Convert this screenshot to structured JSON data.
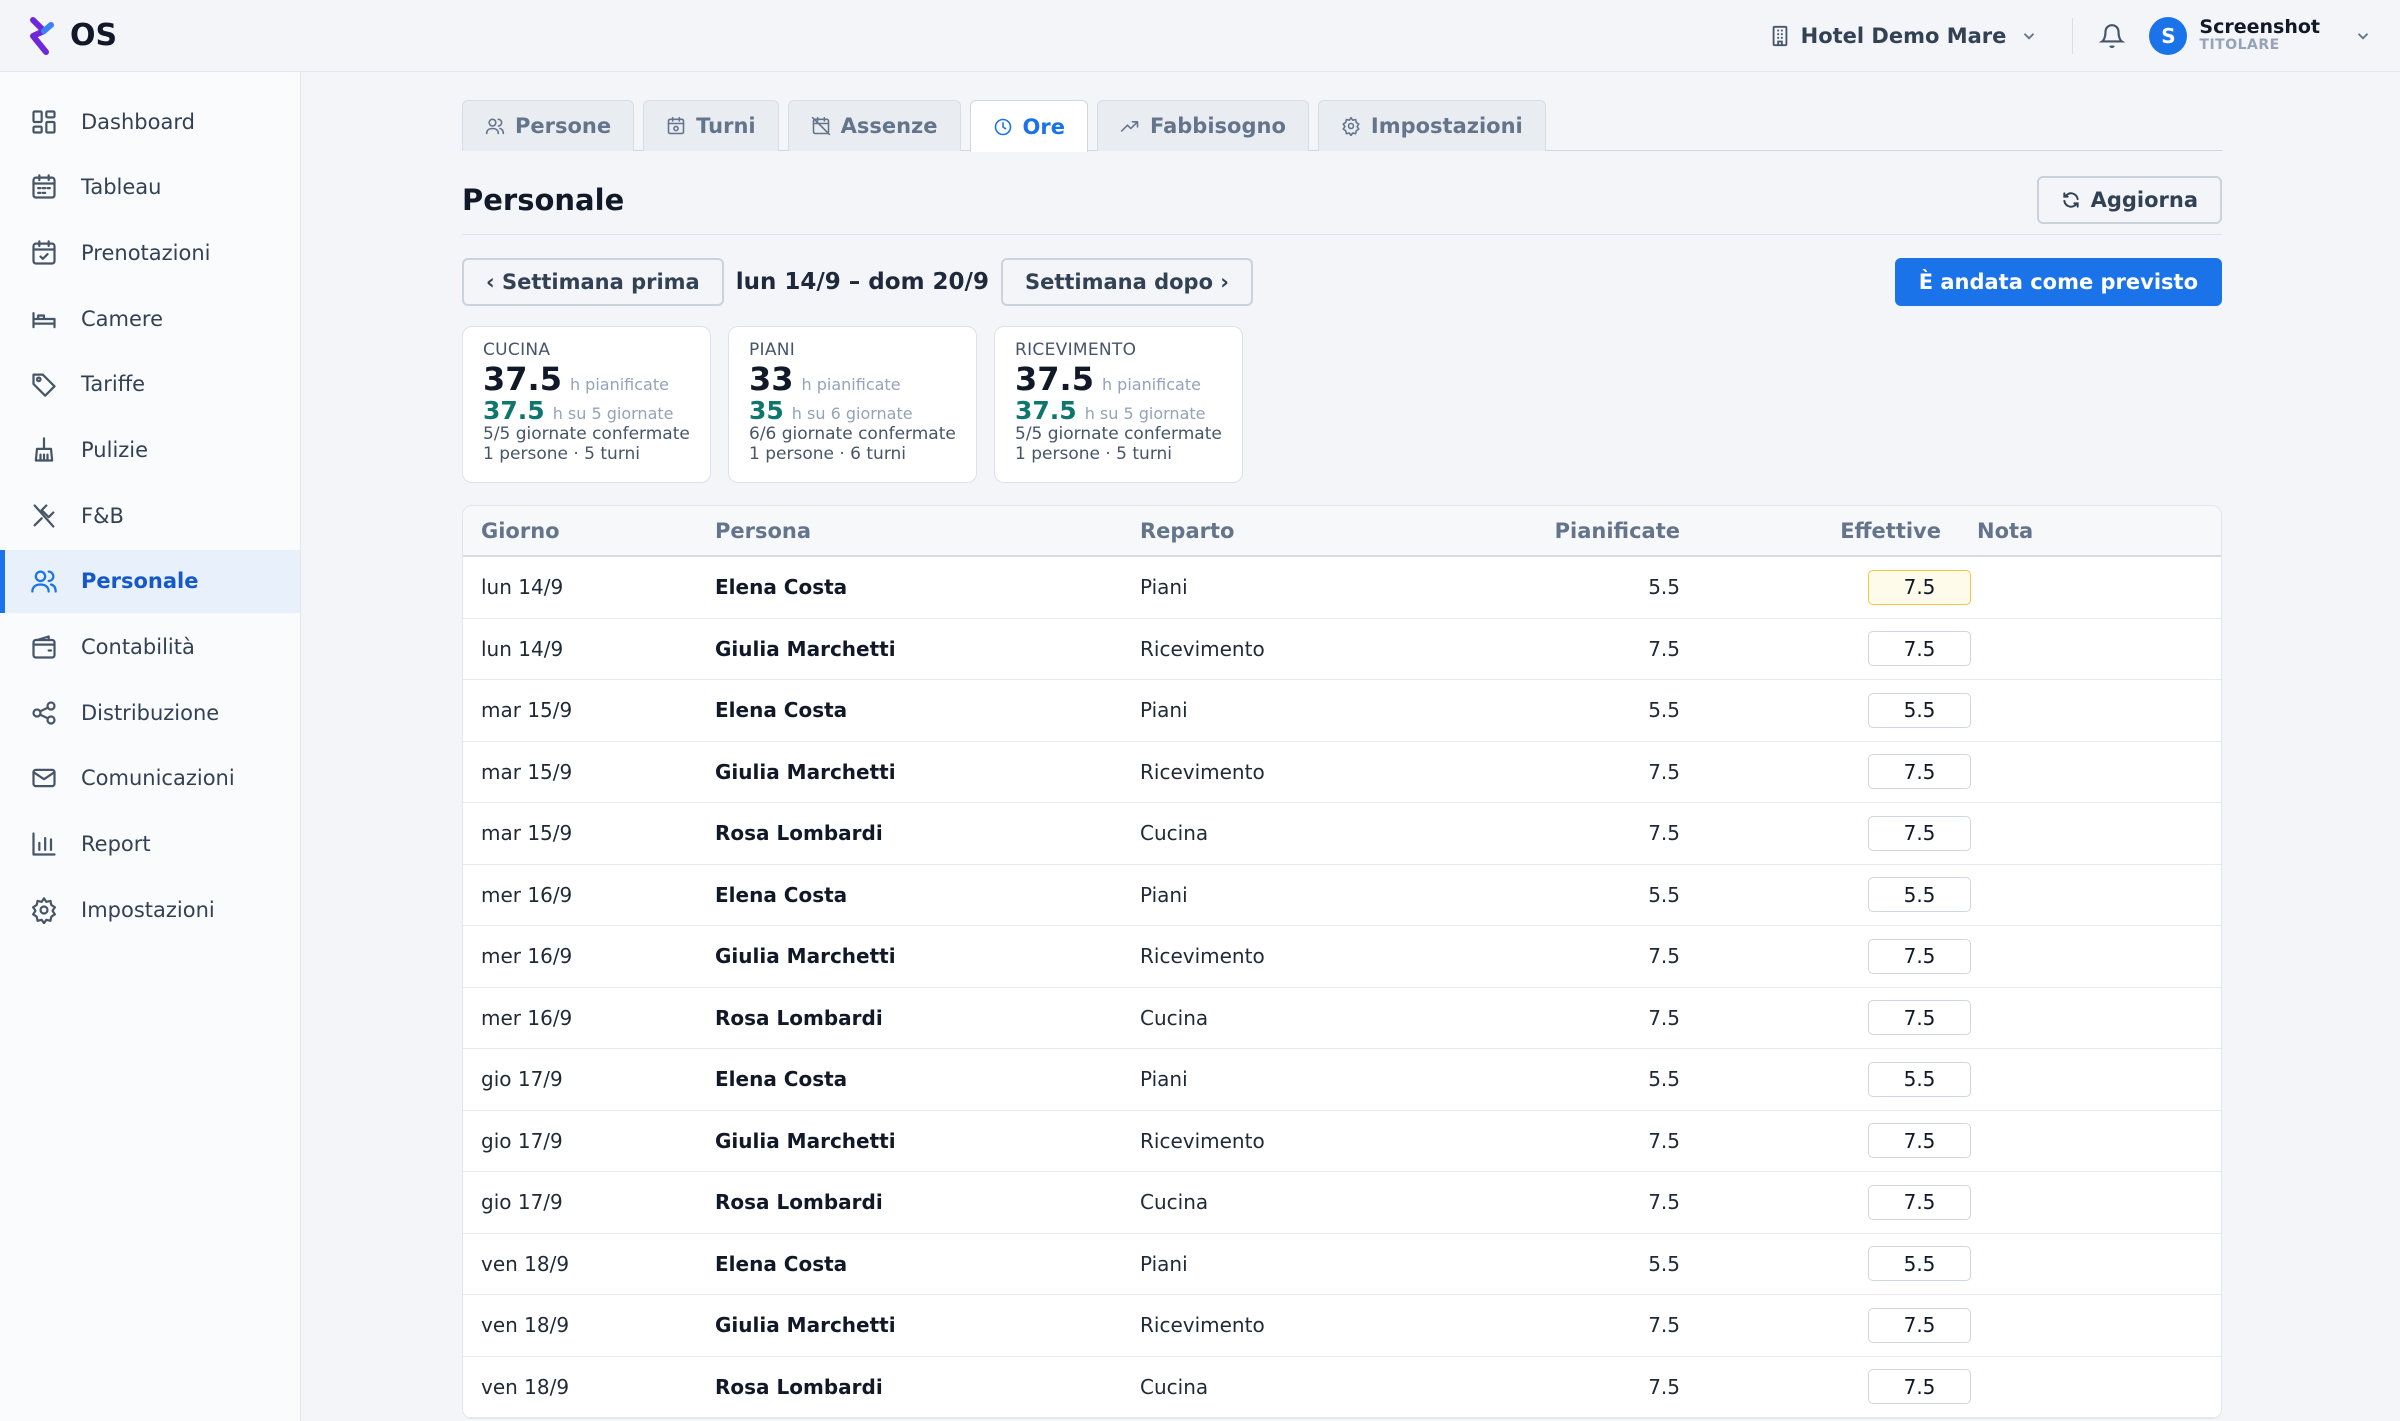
{
  "app": {
    "name": "OS",
    "accent": "#1a73e8"
  },
  "topbar": {
    "hotel": "Hotel Demo Mare",
    "user_initial": "S",
    "user_name": "Screenshot",
    "user_role": "TITOLARE"
  },
  "sidebar": {
    "items": [
      {
        "label": "Dashboard",
        "icon": "dashboard-icon"
      },
      {
        "label": "Tableau",
        "icon": "calendar-grid-icon"
      },
      {
        "label": "Prenotazioni",
        "icon": "calendar-check-icon"
      },
      {
        "label": "Camere",
        "icon": "bed-icon"
      },
      {
        "label": "Tariffe",
        "icon": "tag-icon"
      },
      {
        "label": "Pulizie",
        "icon": "broom-icon"
      },
      {
        "label": "F&B",
        "icon": "utensils-icon"
      },
      {
        "label": "Personale",
        "icon": "users-icon",
        "active": true
      },
      {
        "label": "Contabilità",
        "icon": "wallet-icon"
      },
      {
        "label": "Distribuzione",
        "icon": "share-icon"
      },
      {
        "label": "Comunicazioni",
        "icon": "mail-icon"
      },
      {
        "label": "Report",
        "icon": "bar-chart-icon"
      },
      {
        "label": "Impostazioni",
        "icon": "gear-icon"
      }
    ]
  },
  "tabs": [
    {
      "label": "Persone",
      "icon": "users-icon"
    },
    {
      "label": "Turni",
      "icon": "calendar-icon"
    },
    {
      "label": "Assenze",
      "icon": "calendar-off-icon"
    },
    {
      "label": "Ore",
      "icon": "clock-icon",
      "active": true
    },
    {
      "label": "Fabbisogno",
      "icon": "trending-up-icon"
    },
    {
      "label": "Impostazioni",
      "icon": "gear-icon"
    }
  ],
  "page": {
    "title": "Personale",
    "refresh_label": "Aggiorna",
    "prev_week": "‹ Settimana prima",
    "week_range": "lun 14/9 – dom 20/9",
    "next_week": "Settimana dopo ›",
    "confirm_label": "È andata come previsto"
  },
  "cards": [
    {
      "dept": "CUCINA",
      "planned": "37.5",
      "planned_unit": "h pianificate",
      "actual": "37.5",
      "actual_unit": "h su 5 giornate",
      "confirmed": "5/5 giornate confermate",
      "people": "1 persone · 5 turni"
    },
    {
      "dept": "PIANI",
      "planned": "33",
      "planned_unit": "h pianificate",
      "actual": "35",
      "actual_unit": "h su 6 giornate",
      "confirmed": "6/6 giornate confermate",
      "people": "1 persone · 6 turni"
    },
    {
      "dept": "RICEVIMENTO",
      "planned": "37.5",
      "planned_unit": "h pianificate",
      "actual": "37.5",
      "actual_unit": "h su 5 giornate",
      "confirmed": "5/5 giornate confermate",
      "people": "1 persone · 5 turni"
    }
  ],
  "table": {
    "headers": [
      "Giorno",
      "Persona",
      "Reparto",
      "Pianificate",
      "Effettive",
      "Nota"
    ],
    "rows": [
      {
        "day": "lun 14/9",
        "person": "Elena Costa",
        "dept": "Piani",
        "planned": "5.5",
        "actual": "7.5",
        "highlight": true
      },
      {
        "day": "lun 14/9",
        "person": "Giulia Marchetti",
        "dept": "Ricevimento",
        "planned": "7.5",
        "actual": "7.5"
      },
      {
        "day": "mar 15/9",
        "person": "Elena Costa",
        "dept": "Piani",
        "planned": "5.5",
        "actual": "5.5"
      },
      {
        "day": "mar 15/9",
        "person": "Giulia Marchetti",
        "dept": "Ricevimento",
        "planned": "7.5",
        "actual": "7.5"
      },
      {
        "day": "mar 15/9",
        "person": "Rosa Lombardi",
        "dept": "Cucina",
        "planned": "7.5",
        "actual": "7.5"
      },
      {
        "day": "mer 16/9",
        "person": "Elena Costa",
        "dept": "Piani",
        "planned": "5.5",
        "actual": "5.5"
      },
      {
        "day": "mer 16/9",
        "person": "Giulia Marchetti",
        "dept": "Ricevimento",
        "planned": "7.5",
        "actual": "7.5"
      },
      {
        "day": "mer 16/9",
        "person": "Rosa Lombardi",
        "dept": "Cucina",
        "planned": "7.5",
        "actual": "7.5"
      },
      {
        "day": "gio 17/9",
        "person": "Elena Costa",
        "dept": "Piani",
        "planned": "5.5",
        "actual": "5.5"
      },
      {
        "day": "gio 17/9",
        "person": "Giulia Marchetti",
        "dept": "Ricevimento",
        "planned": "7.5",
        "actual": "7.5"
      },
      {
        "day": "gio 17/9",
        "person": "Rosa Lombardi",
        "dept": "Cucina",
        "planned": "7.5",
        "actual": "7.5"
      },
      {
        "day": "ven 18/9",
        "person": "Elena Costa",
        "dept": "Piani",
        "planned": "5.5",
        "actual": "5.5"
      },
      {
        "day": "ven 18/9",
        "person": "Giulia Marchetti",
        "dept": "Ricevimento",
        "planned": "7.5",
        "actual": "7.5"
      },
      {
        "day": "ven 18/9",
        "person": "Rosa Lombardi",
        "dept": "Cucina",
        "planned": "7.5",
        "actual": "7.5"
      }
    ]
  }
}
